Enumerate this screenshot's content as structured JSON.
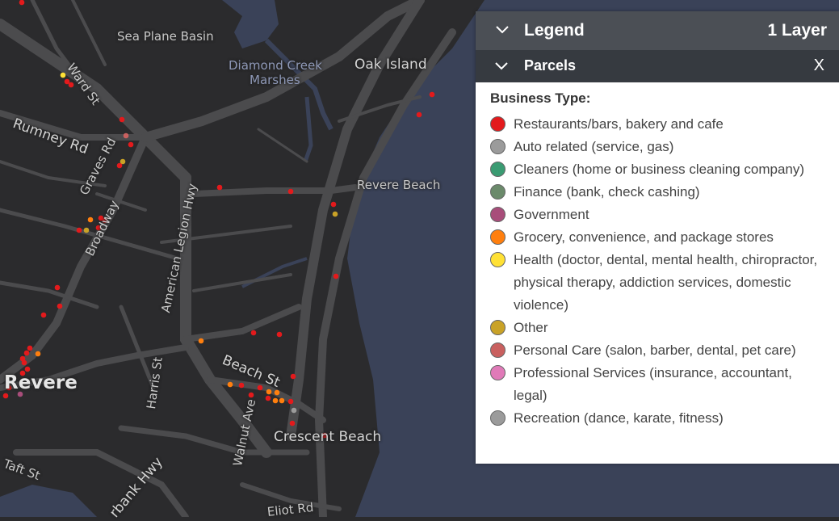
{
  "map": {
    "labels": {
      "sea_plane_basin": "Sea Plane Basin",
      "diamond_creek": "Diamond Creek",
      "marshes": "Marshes",
      "oak_island": "Oak Island",
      "ward_st": "Ward St",
      "rumney_rd": "Rumney Rd",
      "graves_rd": "Graves Rd",
      "broadway": "Broadway",
      "american_legion_hwy": "American Legion Hwy",
      "revere_beach": "Revere Beach",
      "harris_st": "Harris St",
      "beach_st": "Beach St",
      "walnut_ave": "Walnut Ave",
      "crescent_beach": "Crescent Beach",
      "revere": "Revere",
      "taft_st": "Taft St",
      "bank_hwy": "rbank Hwy",
      "eliot_rd": "Eliot Rd"
    },
    "colors": {
      "land": "#2b2b2d",
      "water": "#3a4258",
      "road": "#4b4b4d",
      "label": "#c9c9c9"
    }
  },
  "legend": {
    "title": "Legend",
    "layer_count": "1 Layer",
    "layer": {
      "title": "Parcels",
      "close_label": "X",
      "field": "Business Type:",
      "items": [
        {
          "label": "Restaurants/bars, bakery and cafe",
          "color": "#e31a1c"
        },
        {
          "label": "Auto related (service, gas)",
          "color": "#9b9b9b"
        },
        {
          "label": "Cleaners (home or business cleaning company)",
          "color": "#3a9b72"
        },
        {
          "label": "Finance (bank, check cashing)",
          "color": "#6b8a6b"
        },
        {
          "label": "Government",
          "color": "#a84d7a"
        },
        {
          "label": "Grocery, convenience, and package stores",
          "color": "#ff7f0e"
        },
        {
          "label": "Health (doctor, dental, mental health, chiropractor, physical therapy, addiction services, domestic violence)",
          "color": "#ffe135"
        },
        {
          "label": "Other",
          "color": "#c9a227"
        },
        {
          "label": "Personal Care (salon, barber, dental, pet care)",
          "color": "#c9605f"
        },
        {
          "label": "Professional Services (insurance, accountant, legal)",
          "color": "#e07ab8"
        },
        {
          "label": "Recreation (dance, karate, fitness)",
          "color": "#9b9b9b"
        }
      ]
    }
  }
}
